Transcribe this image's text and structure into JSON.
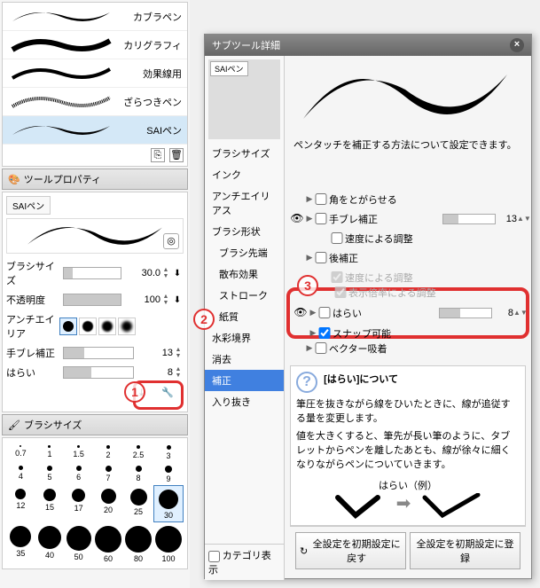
{
  "brush_list": {
    "items": [
      {
        "label": "カブラペン"
      },
      {
        "label": "カリグラフィ"
      },
      {
        "label": "効果線用"
      },
      {
        "label": "ざらつきペン"
      },
      {
        "label": "SAIペン"
      }
    ]
  },
  "tool_property": {
    "title": "ツールプロパティ",
    "tab": "SAIペン",
    "rows": {
      "brush_size": {
        "label": "ブラシサイズ",
        "value": "30.0"
      },
      "opacity": {
        "label": "不透明度",
        "value": "100"
      },
      "antialias": {
        "label": "アンチエイリア"
      },
      "stabilize": {
        "label": "手ブレ補正",
        "value": "13"
      },
      "harai": {
        "label": "はらい",
        "value": "8"
      }
    }
  },
  "brush_size": {
    "title": "ブラシサイズ",
    "sizes": [
      "0.7",
      "1",
      "1.5",
      "2",
      "2.5",
      "3",
      "4",
      "5",
      "6",
      "7",
      "8",
      "9",
      "12",
      "15",
      "17",
      "20",
      "25",
      "30",
      "35",
      "40",
      "50",
      "60",
      "80",
      "100"
    ]
  },
  "dialog": {
    "title": "サブツール詳細",
    "tab": "SAIペン",
    "desc": "ペンタッチを補正する方法について設定できます。",
    "categories": [
      {
        "label": "ブラシサイズ",
        "sub": false
      },
      {
        "label": "インク",
        "sub": false
      },
      {
        "label": "アンチエイリアス",
        "sub": false
      },
      {
        "label": "ブラシ形状",
        "sub": false
      },
      {
        "label": "ブラシ先端",
        "sub": true
      },
      {
        "label": "散布効果",
        "sub": true
      },
      {
        "label": "ストローク",
        "sub": true
      },
      {
        "label": "紙質",
        "sub": true
      },
      {
        "label": "水彩境界",
        "sub": false
      },
      {
        "label": "消去",
        "sub": false
      },
      {
        "label": "補正",
        "sub": false,
        "selected": true
      },
      {
        "label": "入り抜き",
        "sub": false
      }
    ],
    "category_footer": "カテゴリ表示",
    "settings": {
      "sharp_corner": {
        "label": "角をとがらせる"
      },
      "stabilize": {
        "label": "手ブレ補正",
        "value": "13"
      },
      "speed_adjust": {
        "label": "速度による調整"
      },
      "post_correct": {
        "label": "後補正"
      },
      "speed_adjust2": {
        "label": "速度による調整"
      },
      "display_ratio": {
        "label": "表示倍率による調整"
      },
      "harai": {
        "label": "はらい",
        "value": "8"
      },
      "snap": {
        "label": "スナップ可能"
      },
      "vector": {
        "label": "ベクター吸着"
      }
    },
    "info": {
      "title": "[はらい]について",
      "text1": "筆圧を抜きながら線をひいたときに、線が追従する量を変更します。",
      "text2": "値を大きくすると、筆先が長い筆のように、タブレットからペンを離したあとも、線が徐々に細くなりながらペンについていきます。",
      "example_label": "はらい（例）"
    },
    "buttons": {
      "reset": "全設定を初期設定に戻す",
      "register": "全設定を初期設定に登録"
    }
  },
  "annotations": {
    "a1": "1",
    "a2": "2",
    "a3": "3"
  }
}
